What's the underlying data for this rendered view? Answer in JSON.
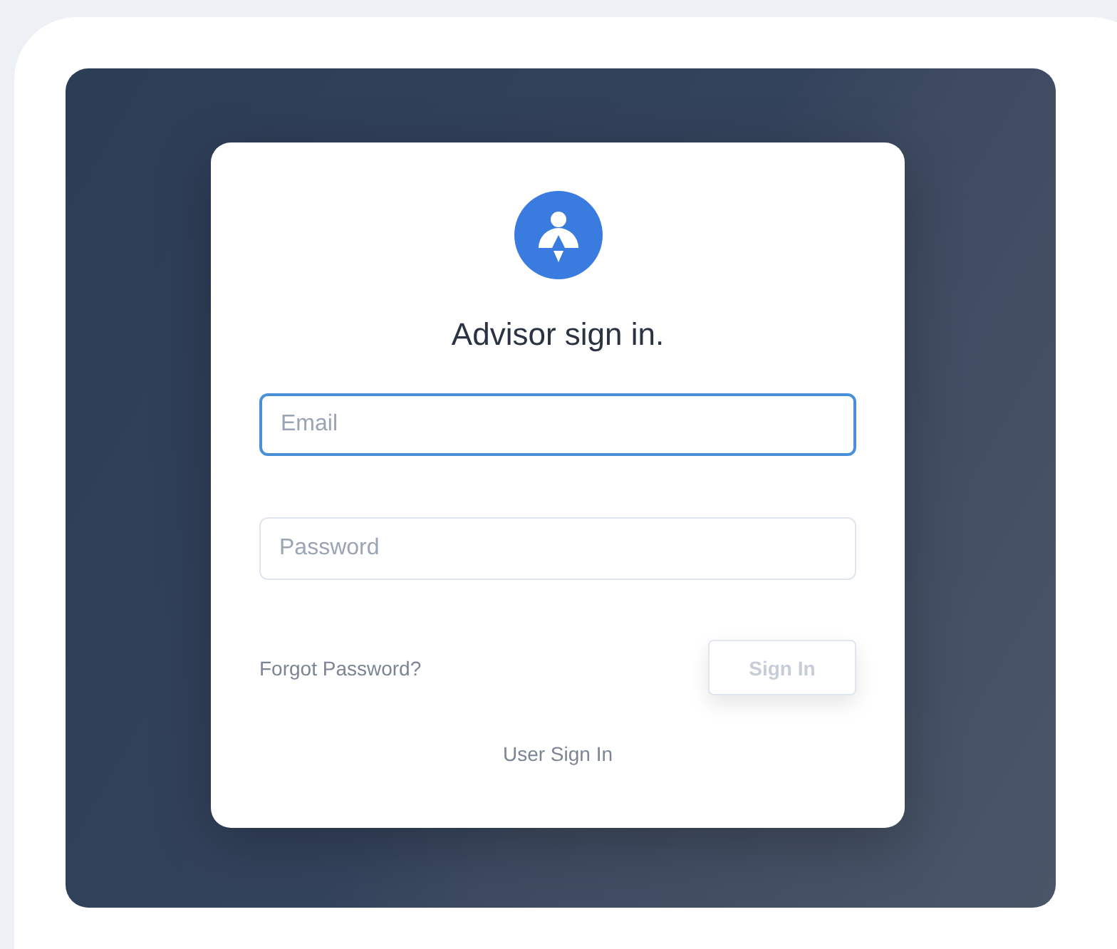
{
  "title": "Advisor sign in.",
  "fields": [
    {
      "placeholder": "Email",
      "focused": true
    },
    {
      "placeholder": "Password",
      "focused": false
    }
  ],
  "forgot_link": "Forgot Password?",
  "sign_in_button": {
    "label": "Sign In",
    "disabled": true
  },
  "user_sign_in_link": "User Sign In"
}
